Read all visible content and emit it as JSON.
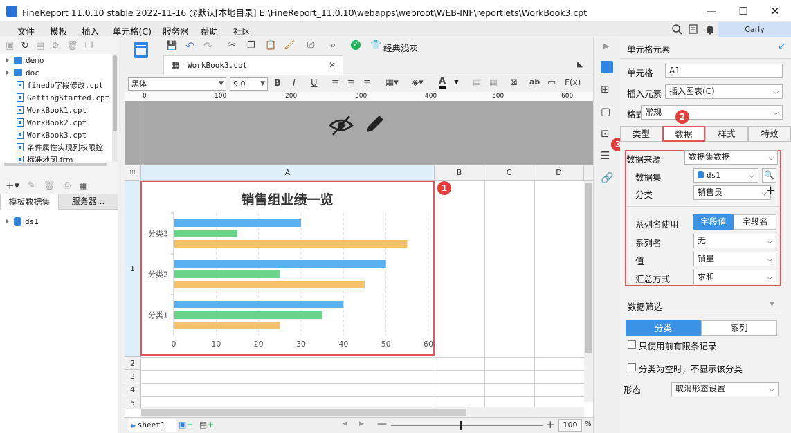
{
  "window": {
    "title": "FineReport 11.0.10 stable 2022-11-16 @默认[本地目录]    E:\\FineReport_11.0.10\\webapps\\webroot\\WEB-INF\\reportlets\\WorkBook3.cpt",
    "minimize": "—",
    "maximize": "☐",
    "close": "✕"
  },
  "menu": [
    "文件",
    "模板",
    "插入",
    "单元格(C)",
    "服务器",
    "帮助",
    "社区"
  ],
  "user": "Carly",
  "file_tree": [
    {
      "type": "folder",
      "label": "demo"
    },
    {
      "type": "folder",
      "label": "doc"
    },
    {
      "type": "file",
      "label": "finedb字段修改.cpt"
    },
    {
      "type": "file",
      "label": "GettingStarted.cpt"
    },
    {
      "type": "file",
      "label": "WorkBook1.cpt"
    },
    {
      "type": "file",
      "label": "WorkBook2.cpt"
    },
    {
      "type": "file",
      "label": "WorkBook3.cpt"
    },
    {
      "type": "file",
      "label": "条件属性实现列权限控"
    },
    {
      "type": "file",
      "label": "标准地图.frm"
    }
  ],
  "left_tabs": [
    "模板数据集",
    "服务器..."
  ],
  "datasets": [
    "ds1"
  ],
  "toolbar": {
    "classic_label": "经典浅灰"
  },
  "doc_tab": "WorkBook3.cpt",
  "format": {
    "font": "黑体",
    "size": "9.0"
  },
  "ruler": [
    "0",
    "100",
    "200",
    "300",
    "400",
    "500",
    "600"
  ],
  "columns": [
    "A",
    "B",
    "C",
    "D"
  ],
  "rows": [
    "1",
    "2",
    "3",
    "4",
    "5"
  ],
  "chart_data": {
    "type": "bar",
    "orientation": "horizontal",
    "title": "销售组业绩一览",
    "categories": [
      "分类1",
      "分类2",
      "分类3"
    ],
    "series": [
      {
        "color": "#5ab1ef",
        "values": [
          40,
          50,
          30
        ]
      },
      {
        "color": "#6bd38a",
        "values": [
          35,
          25,
          15
        ]
      },
      {
        "color": "#f5c26b",
        "values": [
          25,
          45,
          55
        ]
      }
    ],
    "ticks": [
      "0",
      "10",
      "20",
      "30",
      "40",
      "50",
      "60"
    ],
    "xlim": [
      0,
      60
    ]
  },
  "badges": [
    "1",
    "2",
    "3"
  ],
  "sheet_tab": "sheet1",
  "zoom": "100",
  "zoom_unit": "%",
  "panel": {
    "header": "单元格元素",
    "cell_label": "单元格",
    "cell_value": "A1",
    "insert_label": "插入元素",
    "insert_value": "插入图表(C)",
    "format_label": "格式",
    "format_value": "常规",
    "tabs": [
      "类型",
      "数据",
      "样式",
      "特效"
    ],
    "source_label": "数据来源",
    "source_value": "数据集数据",
    "dataset_label": "数据集",
    "dataset_value": "ds1",
    "category_label": "分类",
    "category_value": "销售员",
    "seriesname_use_label": "系列名使用",
    "seg_field_value": "字段值",
    "seg_field_name": "字段名",
    "seriesname_label": "系列名",
    "seriesname_value": "无",
    "value_label": "值",
    "value_value": "销量",
    "agg_label": "汇总方式",
    "agg_value": "求和",
    "filter_label": "数据筛选",
    "filter_tabs": [
      "分类",
      "系列"
    ],
    "check1": "只使用前有限条记录",
    "check2": "分类为空时，不显示该分类",
    "shape_label": "形态",
    "shape_value": "取消形态设置"
  }
}
